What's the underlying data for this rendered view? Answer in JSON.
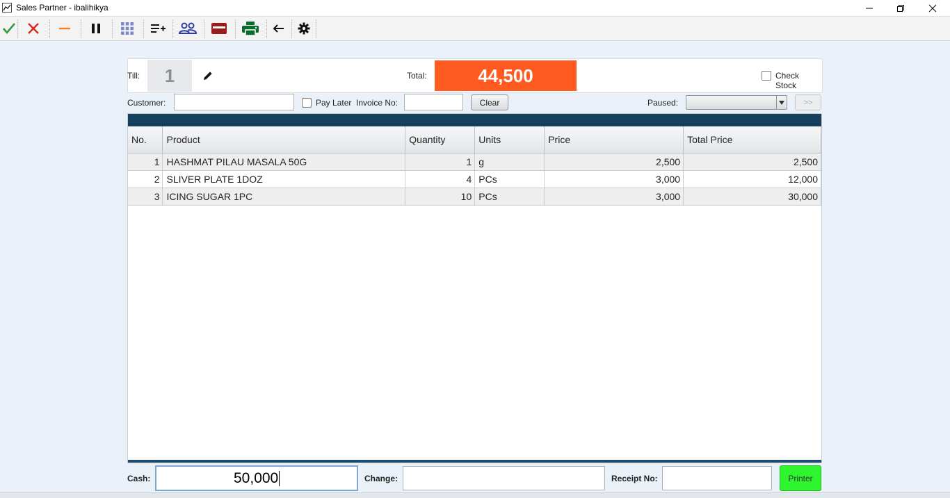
{
  "window": {
    "title": "Sales Partner - ibalihikya",
    "icons": [
      "app-chart-icon",
      "minimize-icon",
      "restore-icon",
      "close-window-icon"
    ]
  },
  "toolbar": {
    "icons": [
      "checkmark-icon",
      "cancel-icon",
      "minus-icon",
      "pause-icon",
      "grid-icon",
      "add-list-icon",
      "customers-icon",
      "card-payment-icon",
      "print-icon",
      "return-icon",
      "settings-icon"
    ],
    "colors": {
      "check": "#2e9e3a",
      "cancel": "#d9261c",
      "minus": "#f07f22",
      "people": "#2d3ea8",
      "card": "#9c1b1b",
      "print": "#0b6b2c"
    }
  },
  "header": {
    "till_label": "Till:",
    "till_value": "1",
    "edit_icon": "pencil-icon",
    "total_label": "Total:",
    "total_value": "44,500",
    "total_color": "#ff5a1f",
    "check_stock_label": "Check Stock"
  },
  "filters": {
    "customer_label": "Customer:",
    "customer_value": "",
    "pay_later_label": "Pay Later",
    "invoice_label": "Invoice No:",
    "invoice_value": "",
    "clear_label": "Clear",
    "paused_label": "Paused:",
    "paused_value": "",
    "next_label": ">>"
  },
  "grid": {
    "columns": [
      "No.",
      "Product",
      "Quantity",
      "Units",
      "Price",
      "Total Price"
    ],
    "rows": [
      {
        "no": "1",
        "product": "HASHMAT PILAU MASALA 50G",
        "quantity": "1",
        "units": "g",
        "price": "2,500",
        "total": "2,500"
      },
      {
        "no": "2",
        "product": "SLIVER PLATE 1DOZ",
        "quantity": "4",
        "units": "PCs",
        "price": "3,000",
        "total": "12,000"
      },
      {
        "no": "3",
        "product": "ICING SUGAR 1PC",
        "quantity": "10",
        "units": "PCs",
        "price": "3,000",
        "total": "30,000"
      }
    ],
    "header_band_color": "#163e5d"
  },
  "footer": {
    "cash_label": "Cash:",
    "cash_value": "50,000",
    "change_label": "Change:",
    "change_value": "",
    "receipt_label": "Receipt No:",
    "receipt_value": "",
    "printer_label": "Printer",
    "printer_color": "#2ef52e"
  }
}
